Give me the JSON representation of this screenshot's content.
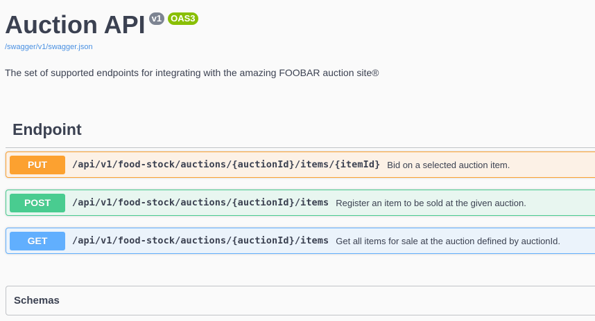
{
  "info": {
    "title": "Auction API",
    "version_badge": "v1",
    "oas_badge": "OAS3",
    "spec_link": "/swagger/v1/swagger.json",
    "description": "The set of supported endpoints for integrating with the amazing FOOBAR auction site®"
  },
  "section": {
    "title": "Endpoint"
  },
  "operations": [
    {
      "method": "PUT",
      "path": "/api/v1/food-stock/auctions/{auctionId}/items/{itemId}",
      "summary": "Bid on a selected auction item."
    },
    {
      "method": "POST",
      "path": "/api/v1/food-stock/auctions/{auctionId}/items",
      "summary": "Register an item to be sold at the given auction."
    },
    {
      "method": "GET",
      "path": "/api/v1/food-stock/auctions/{auctionId}/items",
      "summary": "Get all items for sale at the auction defined by auctionId."
    }
  ],
  "schemas": {
    "title": "Schemas"
  },
  "colors": {
    "put": "#fca130",
    "post": "#49cc90",
    "get": "#61affe",
    "version_badge": "#7d8492",
    "oas_badge": "#89bf04",
    "link": "#4990e2"
  }
}
